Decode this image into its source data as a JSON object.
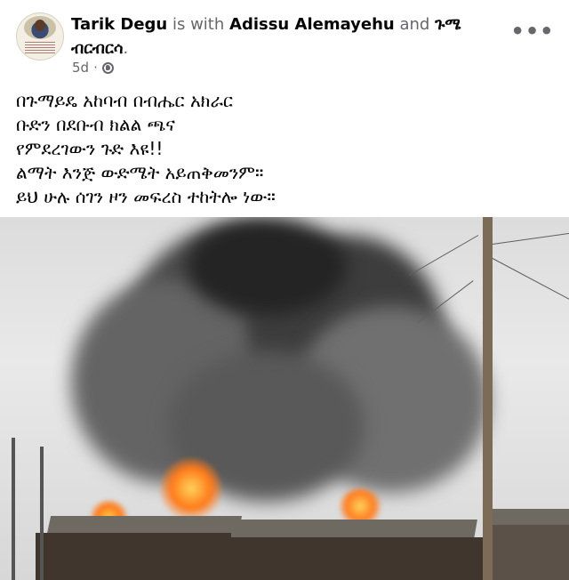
{
  "post": {
    "author": "Tarik Degu",
    "connector_with": "is with",
    "tagged_1": "Adissu Alemayehu",
    "connector_and": "and",
    "tagged_2_line1": "ጉሜ",
    "tagged_2_line2": "ብርብርሳ",
    "tagged_2_suffix": ".",
    "time": "5d",
    "separator": "·",
    "privacy_icon": "globe-icon",
    "more_label": "•••",
    "text_lines": [
      "በጉማይዴ አከባብ በብሔር አክራር",
      "ቡድን በደቡብ ክልል  ጫና",
      "የምደረገውን ጉድ እዩ!!",
      "ልማት እንጅ ውድሜት አይጠቅመንም።",
      "ይህ ሁሉ ሰገን ዞን መፍረስ ተከትሎ ነው።"
    ]
  },
  "colors": {
    "name_text": "#050505",
    "secondary_text": "#65676b",
    "background": "#ffffff"
  }
}
